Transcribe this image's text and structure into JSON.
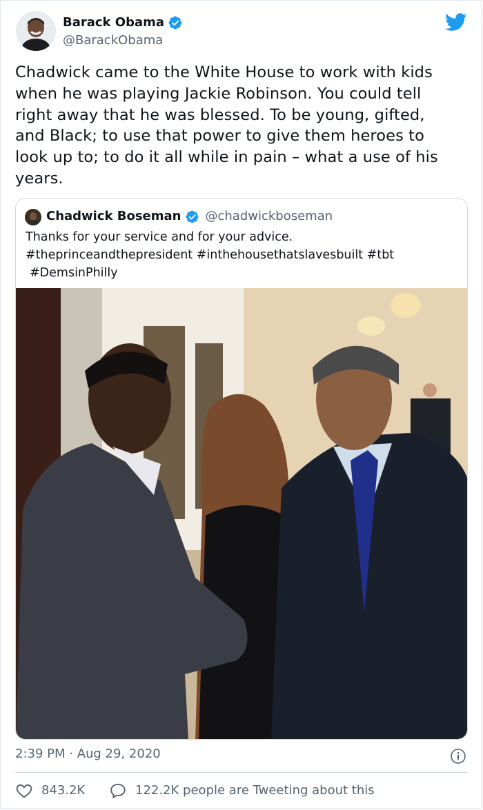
{
  "colors": {
    "brand_blue": "#1d9bf0",
    "text_primary": "#0f1419",
    "text_secondary": "#536471",
    "border": "#cfd9de"
  },
  "tweet": {
    "author_name": "Barack Obama",
    "author_handle": "@BarackObama",
    "verified_icon": "verified-badge-icon",
    "brand_icon": "twitter-bird-icon",
    "text_lines": [
      "Chadwick came to the White House to work with kids",
      "when he was playing Jackie Robinson. You could tell",
      "right away that he was blessed. To be young, gifted,",
      "and Black; to use that power to give them heroes to",
      "look up to; to do it all while in pain – what a use of his",
      "years."
    ],
    "timestamp": "2:39 PM · Aug 29, 2020",
    "likes": "843.2K",
    "conversation": "122.2K people are Tweeting about this"
  },
  "quoted_tweet": {
    "author_name": "Chadwick Boseman",
    "author_handle": "@chadwickboseman",
    "text_lines": [
      "Thanks for your service and for your advice.",
      "#theprinceandthepresident #inthehousethatslavesbuilt #tbt",
      "#DemsinPhilly"
    ]
  }
}
